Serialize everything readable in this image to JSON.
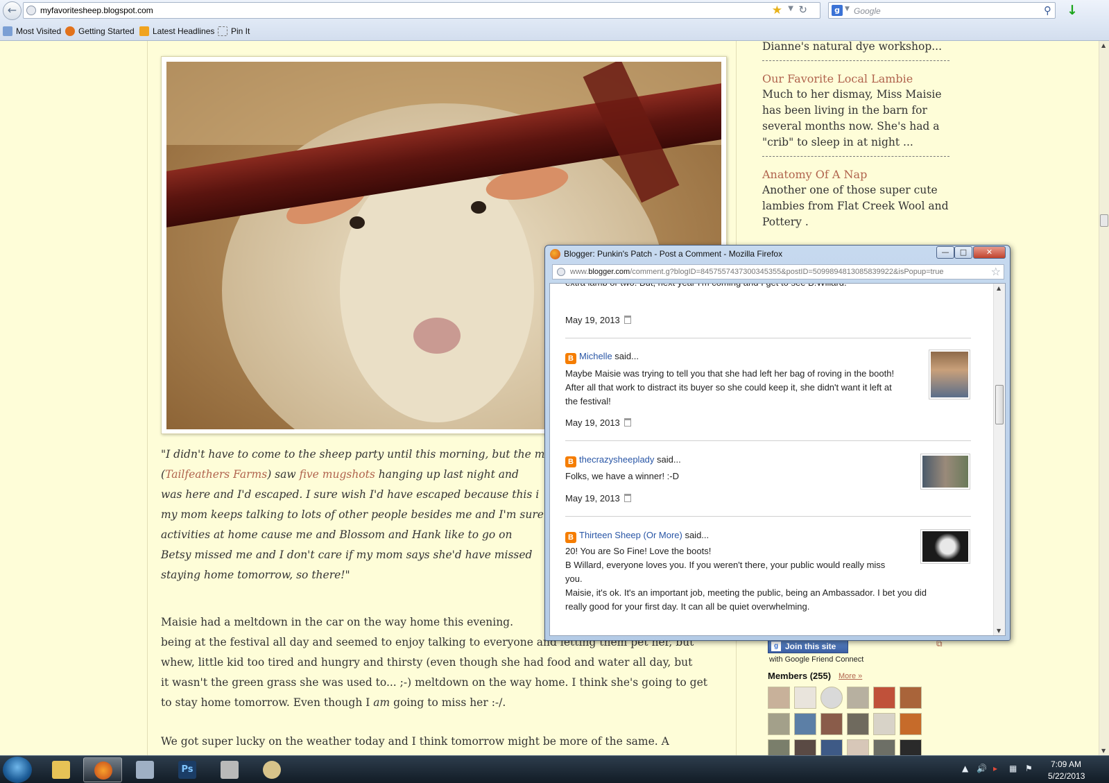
{
  "browser": {
    "url": "myfavoritesheep.blogspot.com",
    "search_placeholder": "Google",
    "bookmarks": [
      "Most Visited",
      "Getting Started",
      "Latest Headlines",
      "Pin It"
    ]
  },
  "post": {
    "quote": {
      "l1": "\"I didn't have to come to the sheep party until this morning, but the m",
      "l2_a": "(",
      "l2_link1": "Tailfeathers Farms",
      "l2_b": ") saw ",
      "l2_link2": "five mugshots",
      "l2_c": " hanging up last night and",
      "l3": "was here and I'd escaped.  I sure wish I'd have escaped because this i",
      "l4": "my mom keeps talking to lots of other people besides me and I'm sure",
      "l5": "activities at home cause me and Blossom and Hank like to go on",
      "l6": "Betsy missed me and I don't care if my mom says she'd have missed",
      "l7": "staying home tomorrow, so there!\""
    },
    "para1": {
      "l1": "Maisie had a meltdown in the car on the way home this evening.",
      "l2": "being at the festival all day and seemed to enjoy talking to everyone and letting them pet her, but",
      "l3": "whew, little kid too tired and hungry and thirsty (even though she had food and water all day, but",
      "l4": "it wasn't the green grass she was used to... ;-) meltdown on the way home.  I think she's going to get",
      "l5_a": "to stay home tomorrow.  Even though I ",
      "l5_em": "am",
      "l5_b": " going to miss her :-/."
    },
    "para2": {
      "l1": "We got super lucky on the weather today and I think tomorrow might be more of the same.  A"
    }
  },
  "sidebar": {
    "top_snippet": "Dianne's natural dye workshop...",
    "posts": [
      {
        "title": "Our Favorite Local Lambie",
        "lines": [
          "Much to her dismay, Miss Maisie",
          "has been living in the barn for",
          "several months now.  She's had a",
          "\"crib\" to sleep in at night ..."
        ]
      },
      {
        "title": "Anatomy Of A Nap",
        "lines": [
          "Another one of those super cute",
          "lambies from Flat Creek Wool and",
          "Pottery ."
        ]
      }
    ],
    "join_label": "Join this site",
    "gfc_label": "with Google Friend Connect",
    "members_label": "Members (255)",
    "more_label": "More »"
  },
  "popup": {
    "title": "Blogger: Punkin's Patch - Post a Comment - Mozilla Firefox",
    "url_prefix": "www.",
    "url_domain": "blogger.com",
    "url_rest": "/comment.g?blogID=8457557437300345355&postID=5099894813085839922&isPopup=true",
    "partial_text": "extra lamb or two. But, next year I'm coming and I get to see B.Willard.",
    "first_date": "May 19, 2013",
    "comments": [
      {
        "author": "Michelle",
        "said": " said...",
        "lines": [
          "Maybe Maisie was trying to tell you that she had left her bag of roving in the booth!",
          "After all that work to distract its buyer so she could keep it, she didn't want it left at",
          "the festival!"
        ],
        "date": "May 19, 2013"
      },
      {
        "author": "thecrazysheeplady",
        "said": " said...",
        "lines": [
          "Folks, we have a winner! :-D"
        ],
        "date": "May 19, 2013"
      },
      {
        "author": "Thirteen Sheep (Or More)",
        "said": " said...",
        "lines": [
          "20! You are So Fine! Love the boots!",
          "B Willard, everyone loves you. If you weren't there, your public would really miss",
          "you.",
          "Maisie, it's ok. It's an important job, meeting the public, being an Ambassador. I bet you did",
          "really good for your first day. It can all be quiet overwhelming."
        ]
      }
    ]
  },
  "taskbar": {
    "time": "7:09 AM",
    "date": "5/22/2013"
  },
  "colors": {
    "page_background": "#fefdd8",
    "link": "#b0634d",
    "comment_author": "#2956a6",
    "blogger_orange": "#f57d00"
  }
}
